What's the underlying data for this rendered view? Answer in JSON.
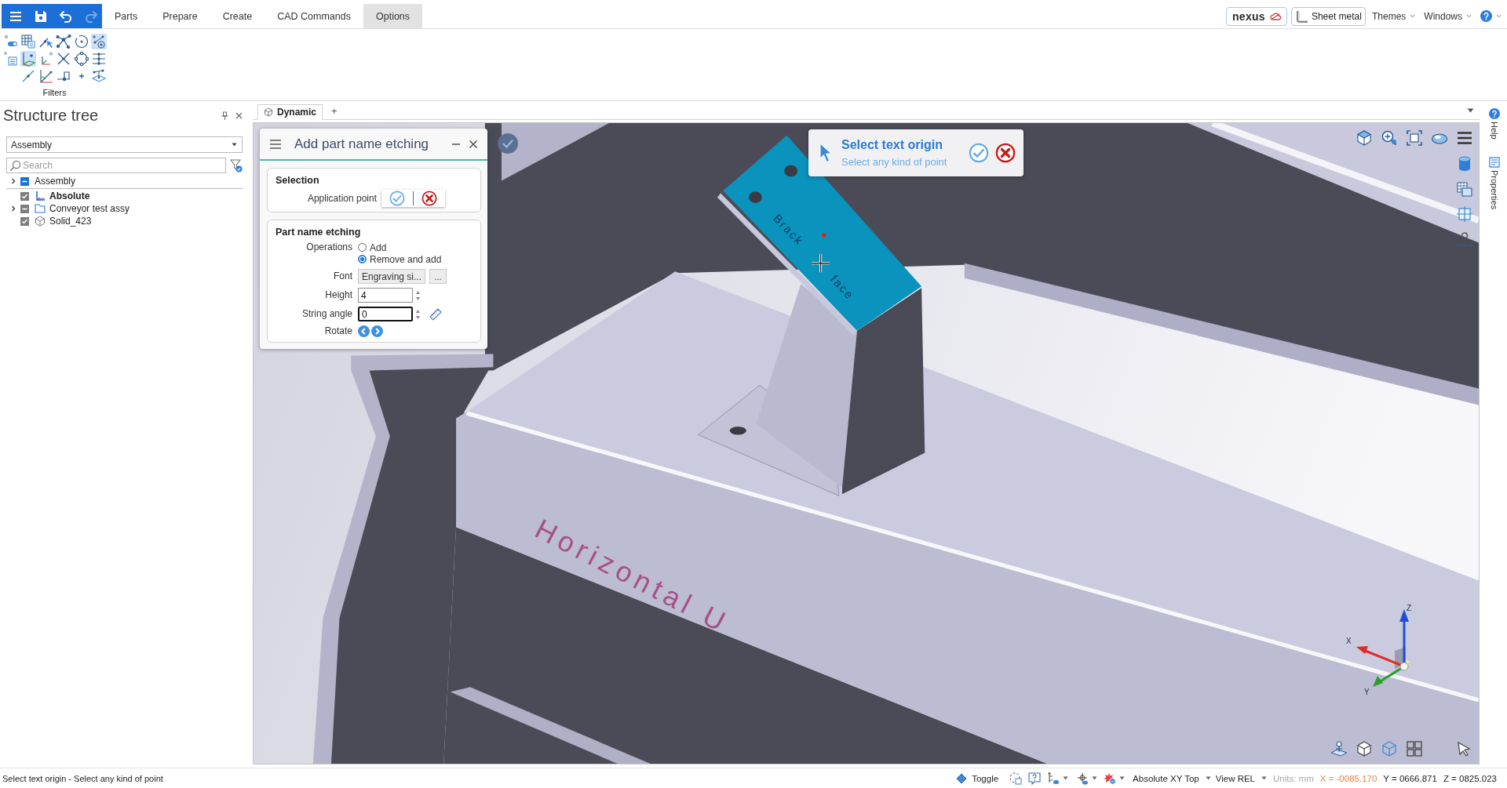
{
  "quick_access": [
    {
      "kind": "menu",
      "disabled": false
    },
    {
      "kind": "save",
      "disabled": false
    },
    {
      "kind": "undo",
      "disabled": false
    },
    {
      "kind": "redo",
      "disabled": true
    }
  ],
  "menu_tabs": [
    {
      "label": "Parts",
      "selected": false
    },
    {
      "label": "Prepare",
      "selected": false
    },
    {
      "label": "Create",
      "selected": false
    },
    {
      "label": "CAD Commands",
      "selected": false
    },
    {
      "label": "Options",
      "selected": true
    }
  ],
  "header_right": {
    "brand": "nexus",
    "sheet_metal": "Sheet metal",
    "menus": [
      "Themes",
      "Windows"
    ]
  },
  "ribbon": {
    "filters": {
      "label": "Filters",
      "rows": [
        [
          {
            "kind": "toggle",
            "selected": false
          },
          {
            "kind": "grid",
            "selected": false
          },
          {
            "kind": "pick",
            "selected": false
          },
          {
            "kind": "network",
            "selected": false
          },
          {
            "kind": "circle",
            "selected": false
          },
          {
            "kind": "snap",
            "selected": true
          }
        ],
        [
          {
            "kind": "sheet",
            "selected": false
          },
          {
            "kind": "plane",
            "selected": true
          },
          {
            "kind": "axes",
            "selected": false
          },
          {
            "kind": "cross",
            "selected": false
          },
          {
            "kind": "ring",
            "selected": false
          },
          {
            "kind": "levels",
            "selected": false
          }
        ],
        [
          {
            "kind": "slant",
            "selected": false
          },
          {
            "kind": "angle",
            "selected": false
          },
          {
            "kind": "dimension",
            "selected": false
          },
          {
            "kind": "plus",
            "selected": false
          },
          {
            "kind": "stack",
            "selected": false
          }
        ]
      ]
    }
  },
  "structure_tree": {
    "title": "Structure tree",
    "view_select": "Assembly",
    "search": {
      "placeholder": "Search"
    },
    "root": {
      "label": "Assembly",
      "has_children": true,
      "checked": false,
      "mixed": true
    },
    "items": [
      {
        "label": "Absolute",
        "kind": "axes",
        "has_children": false,
        "checked": true,
        "mixed": false,
        "active": true
      },
      {
        "label": "Conveyor test assy",
        "kind": "folder",
        "has_children": true,
        "checked": false,
        "mixed": true,
        "active": false
      },
      {
        "label": "Solid_423",
        "kind": "solid",
        "has_children": false,
        "checked": true,
        "mixed": false,
        "active": false
      }
    ]
  },
  "viewport": {
    "tabs": [
      {
        "label": "Dynamic",
        "selected": true
      }
    ],
    "add_tab": "+",
    "model_labels": [
      "Horizontal U",
      "Brack",
      "face"
    ],
    "prompt": {
      "title": "Select text origin",
      "subtitle": "Select any kind of point"
    },
    "axis_labels": [
      "X",
      "Y",
      "Z"
    ]
  },
  "dialog": {
    "title": "Add part name etching",
    "sections": [
      {
        "title": "Selection",
        "rows": [
          {
            "kind": "pick",
            "label": "Application point"
          }
        ]
      },
      {
        "title": "Part name etching",
        "rows": [
          {
            "kind": "radio",
            "label": "Operations",
            "options": [
              {
                "label": "Add",
                "selected": false
              },
              {
                "label": "Remove and add",
                "selected": true
              }
            ]
          },
          {
            "kind": "font",
            "label": "Font",
            "value": "Engraving si...",
            "more": "..."
          },
          {
            "kind": "spin",
            "label": "Height",
            "value": "4",
            "focused": false
          },
          {
            "kind": "angle",
            "label": "String angle",
            "value": "0",
            "focused": true
          },
          {
            "kind": "rotate",
            "label": "Rotate"
          }
        ]
      }
    ]
  },
  "side_tabs": [
    {
      "kind": "help",
      "label": "Help"
    },
    {
      "kind": "properties",
      "label": "Properties"
    }
  ],
  "status_bar": {
    "message": "Select text origin - Select any kind of point",
    "toggle": "Toggle",
    "coordinate_system": "Absolute XY Top",
    "view": "View REL",
    "units": "Units: mm",
    "coordinates": [
      {
        "text": "X = -0085.170",
        "color": "#e8823a"
      },
      {
        "text": "Y = 0666.871",
        "color": "#1a1a1a"
      },
      {
        "text": "Z = 0825.023",
        "color": "#1a1a1a"
      }
    ]
  }
}
